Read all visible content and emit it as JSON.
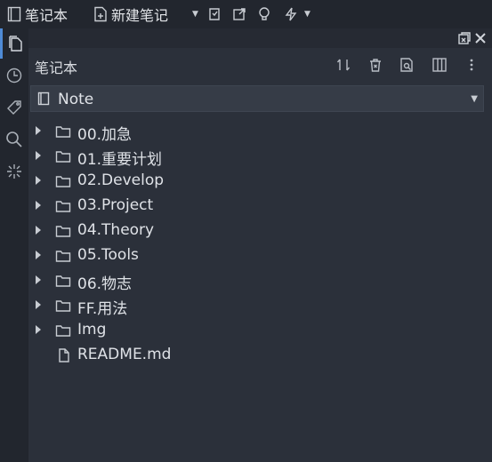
{
  "toolbar": {
    "notebook_label": "笔记本",
    "new_note_label": "新建笔记"
  },
  "panel": {
    "title": "笔记本"
  },
  "notebook_selector": {
    "selected": "Note"
  },
  "tree": {
    "items": [
      {
        "name": "00.加急",
        "type": "folder"
      },
      {
        "name": "01.重要计划",
        "type": "folder"
      },
      {
        "name": "02.Develop",
        "type": "folder"
      },
      {
        "name": "03.Project",
        "type": "folder"
      },
      {
        "name": "04.Theory",
        "type": "folder"
      },
      {
        "name": "05.Tools",
        "type": "folder"
      },
      {
        "name": "06.物志",
        "type": "folder"
      },
      {
        "name": "FF.用法",
        "type": "folder"
      },
      {
        "name": "Img",
        "type": "folder"
      },
      {
        "name": "README.md",
        "type": "file"
      }
    ]
  },
  "colors": {
    "background": "#22262e",
    "panel": "#2b303a",
    "accent": "#4f8bd6"
  }
}
